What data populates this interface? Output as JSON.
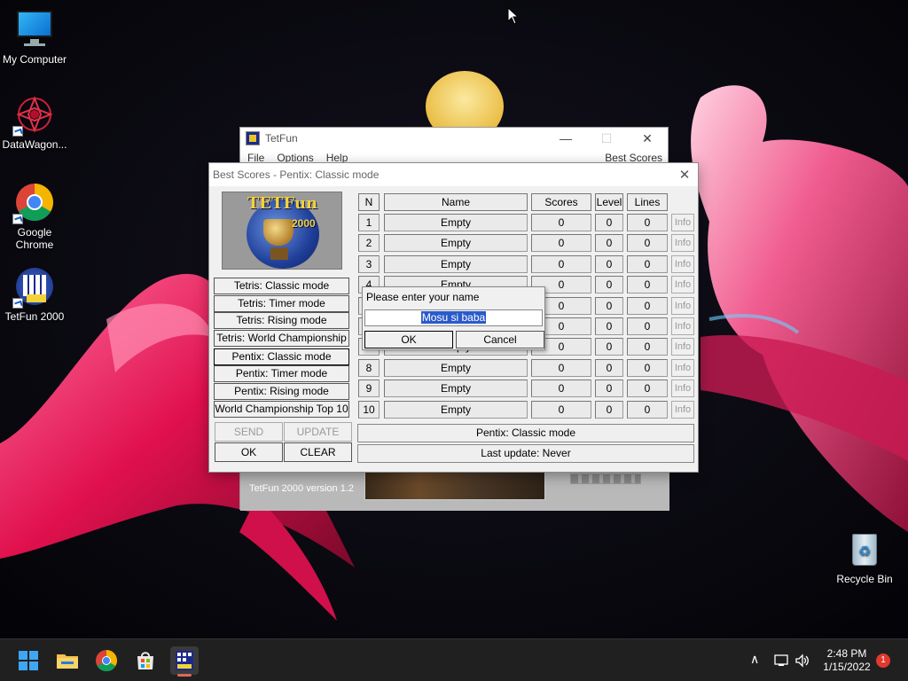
{
  "desktop": {
    "icons": [
      {
        "label": "My Computer"
      },
      {
        "label": "DataWagon..."
      },
      {
        "label": "Google Chrome"
      },
      {
        "label": "TetFun 2000"
      },
      {
        "label": "Recycle Bin"
      }
    ]
  },
  "tetfun_window": {
    "title": "TetFun",
    "controls": {
      "minimize": "—",
      "maximize": "☐",
      "close": "✕"
    },
    "menu": {
      "file": "File",
      "options": "Options",
      "help": "Help",
      "best_scores": "Best Scores"
    },
    "version": "TetFun 2000 version 1.2"
  },
  "best_scores_dialog": {
    "title": "Best Scores - Pentix: Classic mode",
    "close": "✕",
    "logo": {
      "text": "TETFun",
      "year": "2000"
    },
    "modes": [
      "Tetris: Classic mode",
      "Tetris: Timer mode",
      "Tetris: Rising mode",
      "Tetris: World Championship",
      "Pentix: Classic mode",
      "Pentix: Timer mode",
      "Pentix: Rising mode",
      "World Championship Top 10"
    ],
    "active_mode_index": 4,
    "buttons": {
      "send": "SEND",
      "update": "UPDATE",
      "ok": "OK",
      "clear": "CLEAR"
    },
    "table": {
      "headers": {
        "n": "N",
        "name": "Name",
        "scores": "Scores",
        "level": "Level",
        "lines": "Lines"
      },
      "info_label": "Info",
      "rows": [
        {
          "n": "1",
          "name": "Empty",
          "scores": "0",
          "level": "0",
          "lines": "0"
        },
        {
          "n": "2",
          "name": "Empty",
          "scores": "0",
          "level": "0",
          "lines": "0"
        },
        {
          "n": "3",
          "name": "Empty",
          "scores": "0",
          "level": "0",
          "lines": "0"
        },
        {
          "n": "4",
          "name": "Empty",
          "scores": "0",
          "level": "0",
          "lines": "0"
        },
        {
          "n": "5",
          "name": "Empty",
          "scores": "0",
          "level": "0",
          "lines": "0"
        },
        {
          "n": "6",
          "name": "Empty",
          "scores": "0",
          "level": "0",
          "lines": "0"
        },
        {
          "n": "7",
          "name": "Empty",
          "scores": "0",
          "level": "0",
          "lines": "0"
        },
        {
          "n": "8",
          "name": "Empty",
          "scores": "0",
          "level": "0",
          "lines": "0"
        },
        {
          "n": "9",
          "name": "Empty",
          "scores": "0",
          "level": "0",
          "lines": "0"
        },
        {
          "n": "10",
          "name": "Empty",
          "scores": "0",
          "level": "0",
          "lines": "0"
        }
      ]
    },
    "status": {
      "mode": "Pentix: Classic mode",
      "last_update": "Last update: Never"
    }
  },
  "name_prompt": {
    "message": "Please enter your name",
    "value": "Mosu si baba",
    "ok": "OK",
    "cancel": "Cancel"
  },
  "taskbar": {
    "items": [
      "start-icon",
      "file-explorer-icon",
      "chrome-icon",
      "store-icon",
      "tetfun-icon"
    ],
    "tray": {
      "chevron": "∧",
      "time": "2:48 PM",
      "date": "1/15/2022",
      "notifications": "1"
    }
  },
  "colors": {
    "selection": "#2a5acb",
    "notification": "#e0392d",
    "taskbar": "#202020"
  }
}
